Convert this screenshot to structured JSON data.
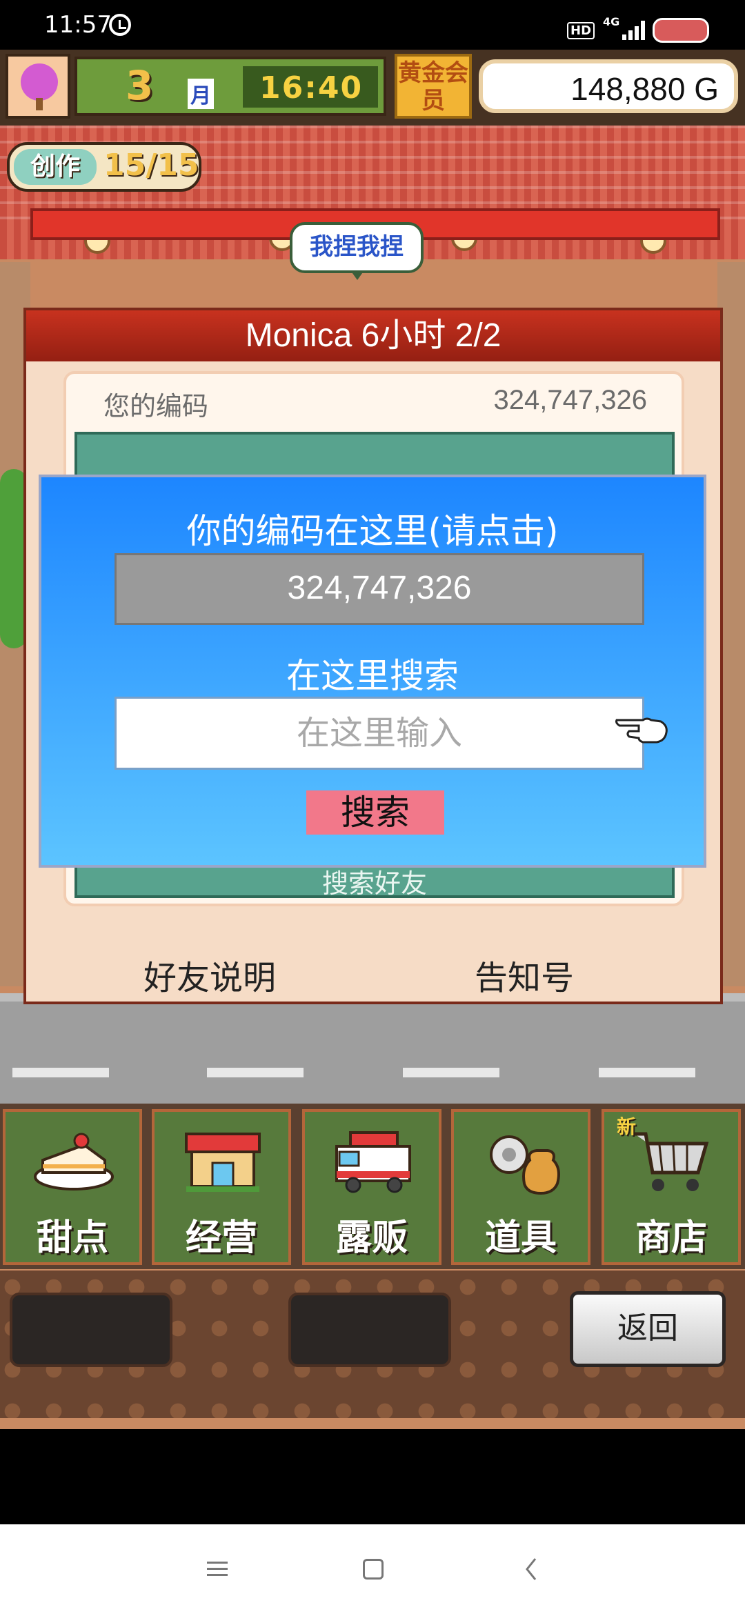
{
  "status_bar": {
    "time": "11:57",
    "hd": "HD",
    "network": "4G"
  },
  "hud": {
    "month_number": "3",
    "month_label": "月",
    "clock": "16:40",
    "gold_member": "黄金会员",
    "money": "148,880 G"
  },
  "create": {
    "label": "创作",
    "count": "15/15"
  },
  "speech_bubble": "我捏我捏",
  "friend_panel": {
    "header": "Monica  6小时 2/2",
    "code_label": "您的编码",
    "code_value": "324,747,326",
    "search_friend_label": "搜索好友",
    "friend_info": "好友说明",
    "notice": "告知号"
  },
  "dialog": {
    "title": "你的编码在这里(请点击)",
    "code": "324,747,326",
    "search_title": "在这里搜索",
    "search_placeholder": "在这里输入",
    "search_button": "搜索"
  },
  "menu": {
    "items": [
      {
        "label": "甜点",
        "icon": "cake-icon"
      },
      {
        "label": "经营",
        "icon": "shop-icon"
      },
      {
        "label": "露贩",
        "icon": "food-truck-icon"
      },
      {
        "label": "道具",
        "icon": "items-icon"
      },
      {
        "label": "商店",
        "icon": "cart-icon"
      }
    ],
    "new_badge": "新"
  },
  "back_button": "返回",
  "colors": {
    "dialog_top": "#1d86ff",
    "dialog_bottom": "#5cc4ff",
    "search_button": "#f2788a",
    "panel_header": "#c8321f",
    "menu_tile": "#577a3c"
  }
}
